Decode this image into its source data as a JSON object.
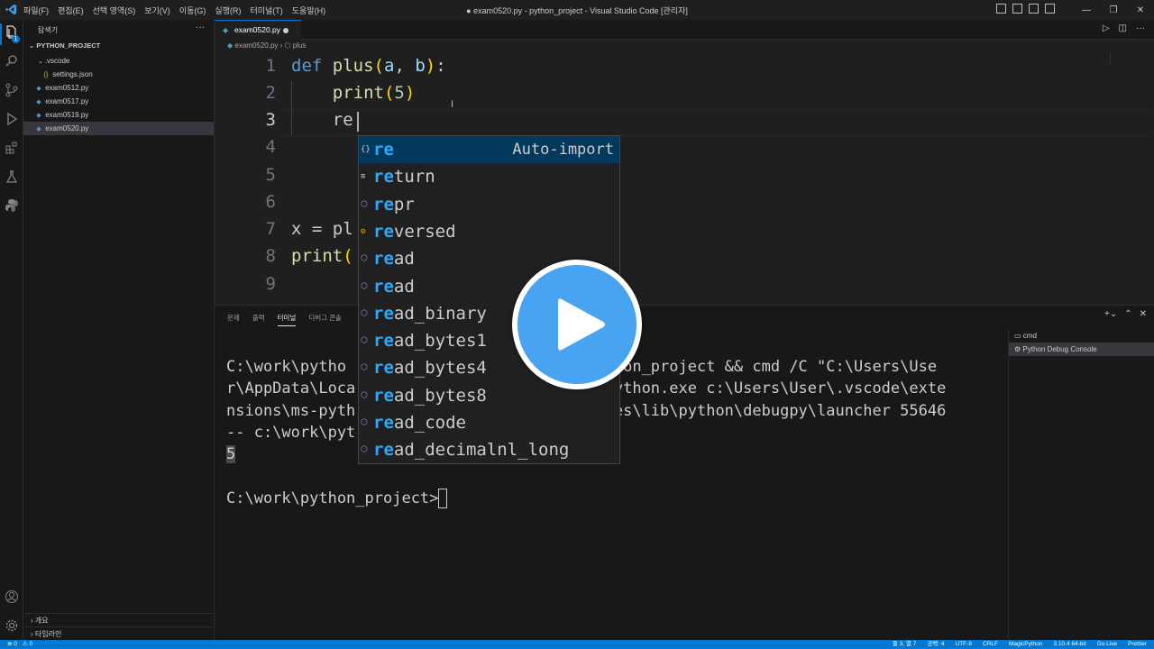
{
  "window": {
    "title": "● exam0520.py - python_project - Visual Studio Code [관리자]",
    "menu": [
      "파일(F)",
      "편집(E)",
      "선택 영역(S)",
      "보기(V)",
      "이동(G)",
      "실행(R)",
      "터미널(T)",
      "도움말(H)"
    ]
  },
  "sidebar": {
    "header": "탐색기",
    "project": "PYTHON_PROJECT",
    "items": [
      {
        "label": ".vscode",
        "type": "folder"
      },
      {
        "label": "settings.json",
        "type": "json"
      },
      {
        "label": "exam0512.py",
        "type": "py"
      },
      {
        "label": "exam0517.py",
        "type": "py"
      },
      {
        "label": "exam0519.py",
        "type": "py"
      },
      {
        "label": "exam0520.py",
        "type": "py",
        "selected": true
      }
    ],
    "outline": "개요",
    "timeline": "타임라인"
  },
  "editor": {
    "tab": "exam0520.py",
    "breadcrumb": [
      "exam0520.py",
      "plus"
    ],
    "line_numbers": [
      "1",
      "2",
      "3",
      "4",
      "5",
      "6",
      "7",
      "8",
      "9"
    ],
    "lines": {
      "l1": {
        "kw": "def",
        "fn": "plus",
        "open": "(",
        "a": "a",
        "comma": ", ",
        "b": "b",
        "close": ")",
        "colon": ":"
      },
      "l2": {
        "indent": "    ",
        "fn": "print",
        "open": "(",
        "num": "5",
        "close": ")"
      },
      "l3": {
        "indent": "    ",
        "text": "re"
      },
      "l7": {
        "text": "x = pl"
      },
      "l8": {
        "fn": "print",
        "open": "("
      }
    }
  },
  "suggest": {
    "items": [
      {
        "match": "re",
        "rest": "",
        "kind": "{}",
        "detail": "Auto-import"
      },
      {
        "match": "re",
        "rest": "turn",
        "kind": "≡"
      },
      {
        "match": "re",
        "rest": "pr",
        "kind": "⬡"
      },
      {
        "match": "re",
        "rest": "versed",
        "kind": "⚙"
      },
      {
        "match": "re",
        "rest": "ad",
        "kind": "⬡"
      },
      {
        "match": "re",
        "rest": "ad",
        "kind": "⬡"
      },
      {
        "match": "re",
        "rest": "ad_binary",
        "kind": "⬡"
      },
      {
        "match": "re",
        "rest": "ad_bytes1",
        "kind": "⬡"
      },
      {
        "match": "re",
        "rest": "ad_bytes4",
        "kind": "⬡"
      },
      {
        "match": "re",
        "rest": "ad_bytes8",
        "kind": "⬡"
      },
      {
        "match": "re",
        "rest": "ad_code",
        "kind": "⬡"
      },
      {
        "match": "re",
        "rest": "ad_decimalnl_long",
        "kind": "⬡"
      }
    ]
  },
  "panel": {
    "tabs": [
      "문제",
      "출력",
      "터미널",
      "디버그 콘솔"
    ],
    "active_tab": "터미널",
    "terminal_lines": [
      "C:\\work\\pytho                          python_project && cmd /C \"C:\\Users\\Use",
      "r\\AppData\\Loca                          \\python.exe c:\\Users\\User\\.vscode\\exte",
      "nsions\\ms-pyth                          iles\\lib\\python\\debugpy\\launcher 55646",
      "-- c:\\work\\pyt"
    ],
    "output_value": "5",
    "prompt": "C:\\work\\python_project>",
    "terminal_list": [
      "cmd",
      "Python Debug Console"
    ]
  },
  "statusbar": {
    "left": [
      "⊗ 0",
      "⚠ 0"
    ],
    "right": [
      "줄 3, 열 7",
      "공백: 4",
      "UTF-8",
      "CRLF",
      "MagicPython",
      "3.10.4 64-bit",
      "Go Live",
      "Prettier"
    ]
  },
  "colors": {
    "accent": "#0078d4",
    "keyword": "#569cd6",
    "function": "#dcdcaa",
    "parameter": "#9cdcfe",
    "match_highlight": "#2aaaff",
    "play_button": "#48a4f0"
  }
}
